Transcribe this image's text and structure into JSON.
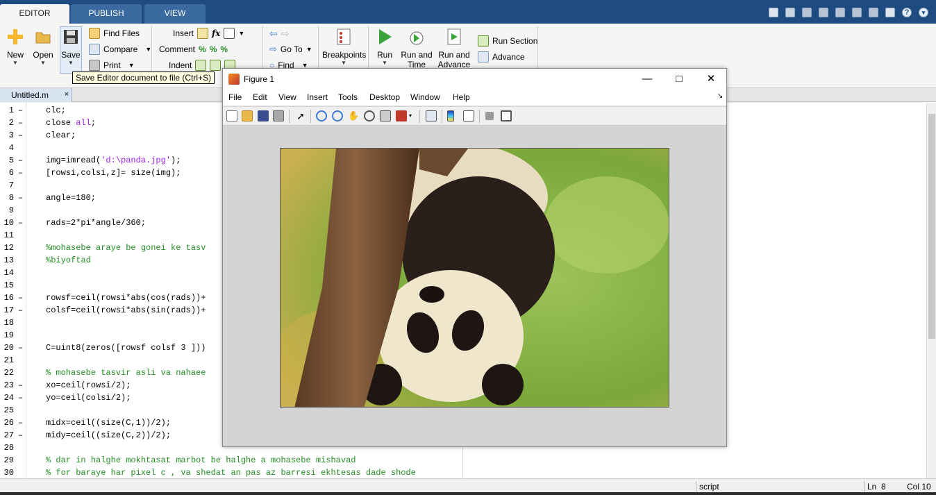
{
  "tabs": [
    {
      "label": "EDITOR",
      "active": true
    },
    {
      "label": "PUBLISH",
      "active": false
    },
    {
      "label": "VIEW",
      "active": false
    }
  ],
  "ribbon": {
    "new_label": "New",
    "open_label": "Open",
    "save_label": "Save",
    "find_files_label": "Find Files",
    "compare_label": "Compare",
    "print_label": "Print",
    "insert_label": "Insert",
    "comment_label": "Comment",
    "indent_label": "Indent",
    "goto_label": "Go To",
    "find_label": "Find",
    "breakpoints_label": "Breakpoints",
    "run_label": "Run",
    "run_time_label_1": "Run and",
    "run_time_label_2": "Time",
    "run_advance_label_1": "Run and",
    "run_advance_label_2": "Advance",
    "run_section_label": "Run Section",
    "advance_label": "Advance",
    "fx_label": "fx"
  },
  "tooltip": "Save Editor document to file (Ctrl+S)",
  "file_tab": {
    "name": "Untitled.m",
    "close": "×"
  },
  "code_lines": [
    {
      "n": "1",
      "d": "–",
      "t": "clc;"
    },
    {
      "n": "2",
      "d": "–",
      "t": "close all;"
    },
    {
      "n": "3",
      "d": "–",
      "t": "clear;"
    },
    {
      "n": "4",
      "d": "",
      "t": ""
    },
    {
      "n": "5",
      "d": "–",
      "t": "img=imread('d:\\panda.jpg');"
    },
    {
      "n": "6",
      "d": "–",
      "t": "[rowsi,colsi,z]= size(img);"
    },
    {
      "n": "7",
      "d": "",
      "t": ""
    },
    {
      "n": "8",
      "d": "–",
      "t": "angle=180;"
    },
    {
      "n": "9",
      "d": "",
      "t": ""
    },
    {
      "n": "10",
      "d": "–",
      "t": "rads=2*pi*angle/360;"
    },
    {
      "n": "11",
      "d": "",
      "t": ""
    },
    {
      "n": "12",
      "d": "",
      "t": "%mohasebe araye be gonei ke tasv"
    },
    {
      "n": "13",
      "d": "",
      "t": "%biyoftad"
    },
    {
      "n": "14",
      "d": "",
      "t": ""
    },
    {
      "n": "15",
      "d": "",
      "t": ""
    },
    {
      "n": "16",
      "d": "–",
      "t": "rowsf=ceil(rowsi*abs(cos(rads))+"
    },
    {
      "n": "17",
      "d": "–",
      "t": "colsf=ceil(rowsi*abs(sin(rads))+"
    },
    {
      "n": "18",
      "d": "",
      "t": ""
    },
    {
      "n": "19",
      "d": "",
      "t": ""
    },
    {
      "n": "20",
      "d": "–",
      "t": "C=uint8(zeros([rowsf colsf 3 ]))"
    },
    {
      "n": "21",
      "d": "",
      "t": ""
    },
    {
      "n": "22",
      "d": "",
      "t": "% mohasebe tasvir asli va nahaee"
    },
    {
      "n": "23",
      "d": "–",
      "t": "xo=ceil(rowsi/2);"
    },
    {
      "n": "24",
      "d": "–",
      "t": "yo=ceil(colsi/2);"
    },
    {
      "n": "25",
      "d": "",
      "t": ""
    },
    {
      "n": "26",
      "d": "–",
      "t": "midx=ceil((size(C,1))/2);"
    },
    {
      "n": "27",
      "d": "–",
      "t": "midy=ceil((size(C,2))/2);"
    },
    {
      "n": "28",
      "d": "",
      "t": ""
    },
    {
      "n": "29",
      "d": "",
      "t": "% dar in halghe mokhtasat marbot be halghe a mohasebe mishavad"
    },
    {
      "n": "30",
      "d": "",
      "t": "% for baraye har pixel c , va shedat an pas az barresi ekhtesas dade shode"
    }
  ],
  "code_parts": {
    "close_kw": "all",
    "imread_pre": "img=imread(",
    "imread_str": "'d:\\panda.jpg'",
    "imread_post": ");"
  },
  "status": {
    "type": "script",
    "ln_label": "Ln",
    "ln": "8",
    "col_label": "Col",
    "col": "10"
  },
  "figure": {
    "title": "Figure 1",
    "min": "—",
    "max": "□",
    "close": "✕",
    "menu": [
      "File",
      "Edit",
      "View",
      "Insert",
      "Tools",
      "Desktop",
      "Window",
      "Help"
    ],
    "dock_arrow": "↘"
  }
}
